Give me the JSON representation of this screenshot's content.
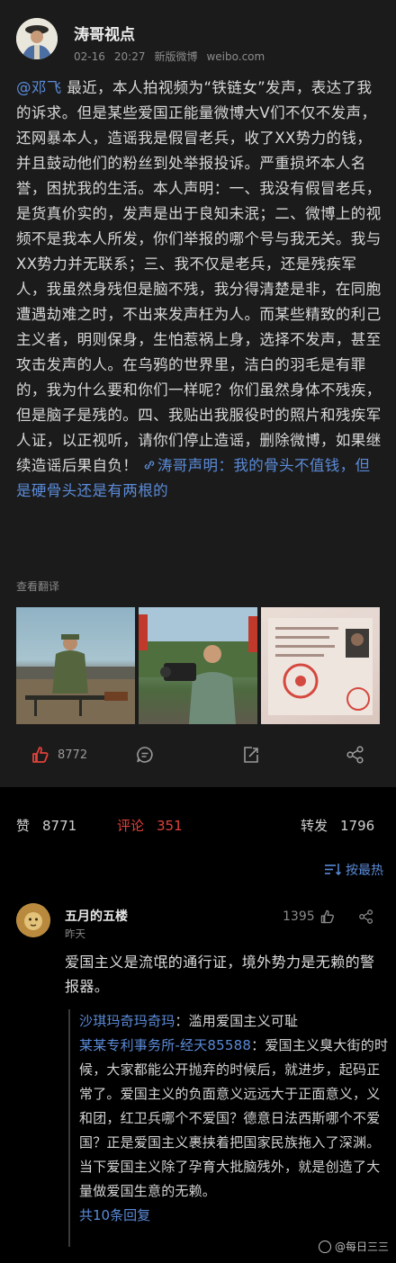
{
  "post": {
    "author": "涛哥视点",
    "date": "02-16",
    "time": "20:27",
    "source": "新版微博",
    "domain": "weibo.com",
    "mention": "@邓飞",
    "text": " 最近，本人拍视频为“铁链女”发声，表达了我的诉求。但是某些爱国正能量微博大V们不仅不发声，还网暴本人，造谣我是假冒老兵，收了XX势力的钱，并且鼓动他们的粉丝到处举报投诉。严重损坏本人名誉，困扰我的生活。本人声明：一、我没有假冒老兵，是货真价实的，发声是出于良知未泯；二、微博上的视频不是我本人所发，你们举报的哪个号与我无关。我与XX势力并无联系；三、我不仅是老兵，还是残疾军人，我虽然身残但是脑不残，我分得清楚是非，在同胞遭遇劫难之时，不出来发声枉为人。而某些精致的利己主义者，明则保身，生怕惹祸上身，选择不发声，甚至攻击发声的人。在乌鸦的世界里，洁白的羽毛是有罪的，我为什么要和你们一样呢？你们虽然身体不残疾，但是脑子是残的。四、我贴出我服役时的照片和残疾军人证，以正视听，请你们停止造谣，删除微博，如果继续造谣后果自负！",
    "link_icon": "link-icon",
    "link_text": "涛哥声明：我的骨头不值钱，但是硬骨头还是有两根的",
    "translate": "查看翻译",
    "like_count": "8772"
  },
  "stats": {
    "likes_label": "赞",
    "likes": "8771",
    "comments_label": "评论",
    "comments": "351",
    "reposts_label": "转发",
    "reposts": "1796",
    "sort_label": "按最热",
    "active_color": "#e0413a",
    "link_color": "#5b8bd9"
  },
  "comment": {
    "author": "五月的五楼",
    "time": "昨天",
    "likes": "1395",
    "text": "爱国主义是流氓的通行证，境外势力是无赖的警报器。",
    "replies": [
      {
        "name": "沙琪玛奇玛奇玛",
        "text": "：滥用爱国主义可耻"
      },
      {
        "name": "某某专利事务所-经天85588",
        "text": "：爱国主义臭大街的时候，大家都能公开抛弃的时候后，就进步，起码正常了。爱国主义的负面意义远远大于正面意义，义和团，红卫兵哪个不爱国？德意日法西斯哪个不爱国？正是爱国主义裹挟着把国家民族拖入了深渊。当下爱国主义除了孕育大批脑残外，就是创造了大量做爱国生意的无赖。"
      }
    ],
    "more_replies": "共10条回复"
  },
  "watermark": "@每日三三"
}
